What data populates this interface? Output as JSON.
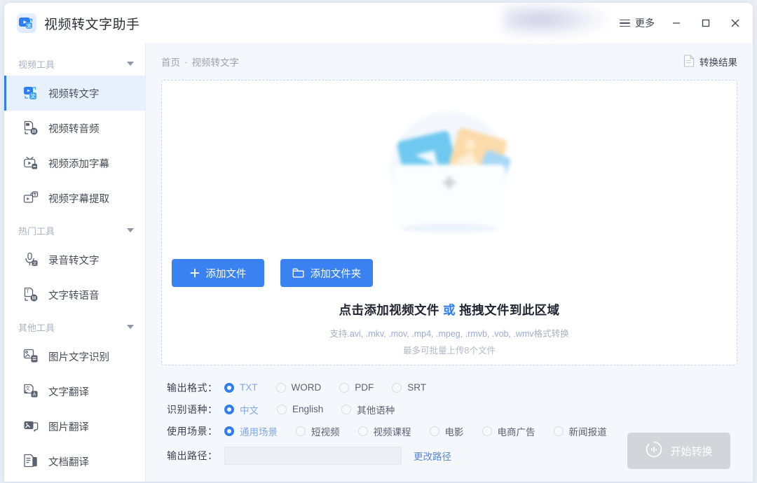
{
  "window": {
    "title": "视频转文字助手",
    "logo_icon": "video-to-text-logo-icon",
    "more_label": "更多",
    "menu_icon": "hamburger-menu-icon",
    "minimize_icon": "minimize-icon",
    "maximize_icon": "maximize-icon",
    "close_icon": "close-icon"
  },
  "sidebar": {
    "groups": [
      {
        "label": "视频工具",
        "caret_icon": "chevron-down-icon",
        "items": [
          {
            "label": "视频转文字",
            "icon": "video-to-text-icon",
            "active": true
          },
          {
            "label": "视频转音频",
            "icon": "video-to-audio-icon",
            "active": false
          },
          {
            "label": "视频添加字幕",
            "icon": "video-add-subtitle-icon",
            "active": false
          },
          {
            "label": "视频字幕提取",
            "icon": "video-extract-subtitle-icon",
            "active": false
          }
        ]
      },
      {
        "label": "热门工具",
        "caret_icon": "chevron-down-icon",
        "items": [
          {
            "label": "录音转文字",
            "icon": "audio-to-text-icon",
            "active": false
          },
          {
            "label": "文字转语音",
            "icon": "text-to-speech-icon",
            "active": false
          }
        ]
      },
      {
        "label": "其他工具",
        "caret_icon": "chevron-down-icon",
        "items": [
          {
            "label": "图片文字识别",
            "icon": "image-ocr-icon",
            "active": false
          },
          {
            "label": "文字翻译",
            "icon": "text-translate-icon",
            "active": false
          },
          {
            "label": "图片翻译",
            "icon": "image-translate-icon",
            "active": false
          },
          {
            "label": "文档翻译",
            "icon": "document-translate-icon",
            "active": false
          }
        ]
      }
    ]
  },
  "breadcrumb": {
    "home": "首页",
    "separator": "-",
    "current": "视频转文字"
  },
  "result_link": {
    "label": "转换结果",
    "icon": "document-result-icon"
  },
  "dropzone": {
    "illustration_icon": "upload-folder-illustration",
    "plus_icon": "plus-icon",
    "title_main": "点击添加视频文件",
    "title_or": "或",
    "title_tail": "拖拽文件到此区域",
    "support_prefix": "支持",
    "support_formats": ".avi, .mkv, .mov, .mp4, .mpeg, .rmvb, .vob, .wmv",
    "support_suffix": "格式转换",
    "note": "最多可批量上传8个文件",
    "add_file_button": "添加文件",
    "add_file_icon": "plus-icon",
    "add_folder_button": "添加文件夹",
    "add_folder_icon": "folder-icon"
  },
  "options": {
    "format": {
      "label": "输出格式：",
      "choices": [
        "TXT",
        "WORD",
        "PDF",
        "SRT"
      ],
      "selected": "TXT"
    },
    "language": {
      "label": "识别语种：",
      "choices": [
        "中文",
        "English",
        "其他语种"
      ],
      "selected": "中文"
    },
    "scene": {
      "label": "使用场景：",
      "choices": [
        "通用场景",
        "短视频",
        "视频课程",
        "电影",
        "电商广告",
        "新闻报道"
      ],
      "selected": "通用场景"
    },
    "output_path": {
      "label": "输出路径：",
      "value": "",
      "placeholder": "",
      "change_label": "更改路径"
    }
  },
  "start_button": {
    "label": "开始转换",
    "icon": "convert-icon",
    "enabled": false
  },
  "colors": {
    "accent": "#2f7ef0",
    "button_primary": "#3a82f1",
    "sidebar_active_bg": "#e7f0fd",
    "disabled": "#d2d5da",
    "content_bg": "#f4f7fc"
  }
}
